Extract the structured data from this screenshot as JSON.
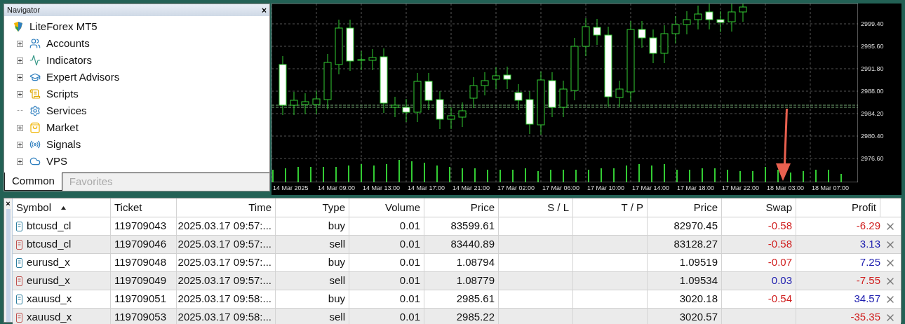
{
  "navigator": {
    "title": "Navigator",
    "close": "×",
    "root": "LiteForex MT5",
    "items": [
      {
        "label": "Accounts",
        "has_children": true
      },
      {
        "label": "Indicators",
        "has_children": true
      },
      {
        "label": "Expert Advisors",
        "has_children": true
      },
      {
        "label": "Scripts",
        "has_children": true
      },
      {
        "label": "Services",
        "has_children": false
      },
      {
        "label": "Market",
        "has_children": true
      },
      {
        "label": "Signals",
        "has_children": true
      },
      {
        "label": "VPS",
        "has_children": true
      }
    ],
    "tabs": [
      {
        "label": "Common",
        "selected": true
      },
      {
        "label": "Favorites",
        "selected": false
      }
    ]
  },
  "chart": {
    "price_labels": [
      "2999.40",
      "2995.60",
      "2991.80",
      "2988.00",
      "2984.20",
      "2980.40",
      "2976.60"
    ],
    "time_labels": [
      "14 Mar 2025",
      "14 Mar 09:00",
      "14 Mar 13:00",
      "14 Mar 17:00",
      "14 Mar 21:00",
      "17 Mar 02:00",
      "17 Mar 06:00",
      "17 Mar 10:00",
      "17 Mar 14:00",
      "17 Mar 18:00",
      "17 Mar 22:00",
      "18 Mar 03:00",
      "18 Mar 07:00"
    ]
  },
  "table": {
    "close": "×",
    "columns": [
      {
        "label": "Symbol",
        "sorted": true
      },
      {
        "label": "Ticket",
        "sorted": false
      },
      {
        "label": "Time",
        "sorted": false
      },
      {
        "label": "Type",
        "sorted": false
      },
      {
        "label": "Volume",
        "sorted": false
      },
      {
        "label": "Price",
        "sorted": false
      },
      {
        "label": "S / L",
        "sorted": false
      },
      {
        "label": "T / P",
        "sorted": false
      },
      {
        "label": "Price",
        "sorted": false
      },
      {
        "label": "Swap",
        "sorted": false
      },
      {
        "label": "Profit",
        "sorted": false
      }
    ],
    "rows": [
      {
        "symbol": "btcusd_cl",
        "kind": "buy",
        "ticket": "119709043",
        "time": "2025.03.17 09:57:...",
        "type": "buy",
        "volume": "0.01",
        "price": "83599.61",
        "current_price": "82970.45",
        "swap": {
          "text": "-0.58",
          "color": "#d02020"
        },
        "profit": {
          "text": "-6.29",
          "color": "#d02020"
        }
      },
      {
        "symbol": "btcusd_cl",
        "kind": "sell",
        "ticket": "119709046",
        "time": "2025.03.17 09:57:...",
        "type": "sell",
        "volume": "0.01",
        "price": "83440.89",
        "current_price": "83128.27",
        "swap": {
          "text": "-0.58",
          "color": "#d02020"
        },
        "profit": {
          "text": "3.13",
          "color": "#2020b0"
        }
      },
      {
        "symbol": "eurusd_x",
        "kind": "buy",
        "ticket": "119709048",
        "time": "2025.03.17 09:57:...",
        "type": "buy",
        "volume": "0.01",
        "price": "1.08794",
        "current_price": "1.09519",
        "swap": {
          "text": "-0.07",
          "color": "#d02020"
        },
        "profit": {
          "text": "7.25",
          "color": "#2020b0"
        }
      },
      {
        "symbol": "eurusd_x",
        "kind": "sell",
        "ticket": "119709049",
        "time": "2025.03.17 09:57:...",
        "type": "sell",
        "volume": "0.01",
        "price": "1.08779",
        "current_price": "1.09534",
        "swap": {
          "text": "0.03",
          "color": "#2020b0"
        },
        "profit": {
          "text": "-7.55",
          "color": "#d02020"
        }
      },
      {
        "symbol": "xauusd_x",
        "kind": "buy",
        "ticket": "119709051",
        "time": "2025.03.17 09:58:...",
        "type": "buy",
        "volume": "0.01",
        "price": "2985.61",
        "current_price": "3020.18",
        "swap": {
          "text": "-0.54",
          "color": "#d02020"
        },
        "profit": {
          "text": "34.57",
          "color": "#2020b0"
        }
      },
      {
        "symbol": "xauusd_x",
        "kind": "sell",
        "ticket": "119709053",
        "time": "2025.03.17 09:58:...",
        "type": "sell",
        "volume": "0.01",
        "price": "2985.22",
        "current_price": "3020.57",
        "profit": {
          "text": "-35.35",
          "color": "#d02020"
        }
      }
    ]
  }
}
